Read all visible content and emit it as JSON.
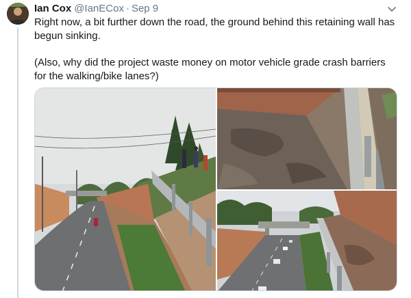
{
  "tweet": {
    "author_name": "Ian Cox",
    "author_handle": "@IanECox",
    "separator": "·",
    "date": "Sep 9",
    "text": "Right now, a bit further down the road, the ground behind this retaining wall has begun sinking.\n\n(Also, why did the project waste money on motor vehicle grade crash barriers for the walking/bike lanes?)"
  },
  "icons": {
    "avatar": "avatar-image",
    "menu": "chevron-down-icon"
  },
  "colors": {
    "secondary_text": "#657786",
    "primary_text": "#14171a",
    "border": "#ccd6dd"
  }
}
